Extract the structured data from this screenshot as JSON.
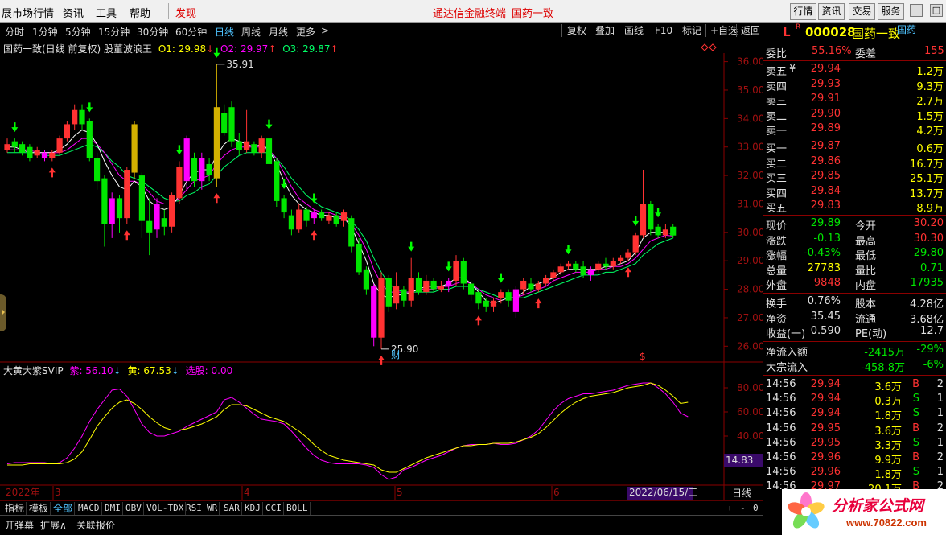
{
  "menubar": {
    "items": [
      "展市场行情",
      "资讯",
      "工具",
      "帮助"
    ],
    "discover": "发现",
    "center_title": "通达信金融终端",
    "center_stock": "国药一致",
    "right_buttons": [
      "行情",
      "资讯",
      "交易",
      "服务"
    ]
  },
  "periods": {
    "items": [
      "分时",
      "1分钟",
      "5分钟",
      "15分钟",
      "30分钟",
      "60分钟",
      "日线",
      "周线",
      "月线",
      "更多"
    ],
    "active": "日线",
    "more_arrow": ">",
    "tools": [
      "复权",
      "叠加",
      "画线",
      "F10",
      "标记",
      "+自选",
      "返回"
    ]
  },
  "main_indicator": {
    "title": "国药一致(日线 前复权) 股董波浪王",
    "o1": "O1: 29.98",
    "o2": "O2: 29.97",
    "o3": "O3: 29.87",
    "high_label": "35.91",
    "low_label": "25.90",
    "fin_marker": "财",
    "s_marker": "$",
    "price_ticks": [
      "36.00",
      "35.00",
      "34.00",
      "33.00",
      "32.00",
      "31.00",
      "30.00",
      "29.00",
      "28.00",
      "27.00",
      "26.00"
    ]
  },
  "sub_indicator": {
    "title": "大黄大紫SVIP",
    "purple": "紫: 56.10",
    "yellow": "黄: 67.53",
    "select": "选股: 0.00",
    "ticks": [
      "80.00",
      "60.00",
      "40.00"
    ],
    "cursor_value": "14.83"
  },
  "date_axis": {
    "year": "2022年",
    "months": [
      "3",
      "4",
      "5",
      "6"
    ],
    "cursor_date": "2022/06/15/三",
    "period_label": "日线",
    "zoom": [
      "+",
      "-",
      "0"
    ]
  },
  "tabs": [
    "指标",
    "模板",
    "全部",
    "MACD",
    "DMI",
    "OBV",
    "VOL-TDX",
    "RSI",
    "WR",
    "SAR",
    "KDJ",
    "CCI",
    "BOLL"
  ],
  "active_tab": "全部",
  "status": [
    "开弹幕",
    "扩展∧",
    "关联报价"
  ],
  "quote": {
    "flag": "L",
    "r_mark": "R",
    "code": "000028",
    "name": "国药一致",
    "tag": "国药",
    "weibi_label": "委比",
    "weibi": "55.16%",
    "weicha_label": "委差",
    "weicha": "155",
    "asks": [
      {
        "label": "卖五",
        "mark": "¥",
        "price": "29.94",
        "vol": "1.2万"
      },
      {
        "label": "卖四",
        "mark": "",
        "price": "29.93",
        "vol": "9.3万"
      },
      {
        "label": "卖三",
        "mark": "",
        "price": "29.91",
        "vol": "2.7万"
      },
      {
        "label": "卖二",
        "mark": "",
        "price": "29.90",
        "vol": "1.5万"
      },
      {
        "label": "卖一",
        "mark": "",
        "price": "29.89",
        "vol": "4.2万"
      }
    ],
    "bids": [
      {
        "label": "买一",
        "price": "29.87",
        "vol": "0.6万"
      },
      {
        "label": "买二",
        "price": "29.86",
        "vol": "16.7万"
      },
      {
        "label": "买三",
        "price": "29.85",
        "vol": "25.1万"
      },
      {
        "label": "买四",
        "price": "29.84",
        "vol": "13.7万"
      },
      {
        "label": "买五",
        "price": "29.83",
        "vol": "8.9万"
      }
    ],
    "stats": [
      {
        "l1": "现价",
        "v1": "29.89",
        "c1": "grn",
        "l2": "今开",
        "v2": "30.20",
        "c2": "red"
      },
      {
        "l1": "涨跌",
        "v1": "-0.13",
        "c1": "grn",
        "l2": "最高",
        "v2": "30.30",
        "c2": "red"
      },
      {
        "l1": "涨幅",
        "v1": "-0.43%",
        "c1": "grn",
        "l2": "最低",
        "v2": "29.80",
        "c2": "grn"
      },
      {
        "l1": "总量",
        "v1": "27783",
        "c1": "yel",
        "l2": "量比",
        "v2": "0.71",
        "c2": "grn"
      },
      {
        "l1": "外盘",
        "v1": "9848",
        "c1": "red",
        "l2": "内盘",
        "v2": "17935",
        "c2": "grn"
      }
    ],
    "fund": [
      {
        "l1": "换手",
        "v1": "0.76%",
        "l2": "股本",
        "v2": "4.28亿"
      },
      {
        "l1": "净资",
        "v1": "35.45",
        "l2": "流通",
        "v2": "3.68亿"
      },
      {
        "l1": "收益(一)",
        "v1": "0.590",
        "l2": "PE(动)",
        "v2": "12.7"
      }
    ],
    "flow": [
      {
        "label": "净流入额",
        "value": "-2415万",
        "pct": "-29%"
      },
      {
        "label": "大宗流入",
        "value": "-458.8万",
        "pct": "-6%"
      }
    ],
    "ticks": [
      {
        "time": "14:56",
        "price": "29.94",
        "vol": "3.6万",
        "bs": "B",
        "n": "2"
      },
      {
        "time": "14:56",
        "price": "29.94",
        "vol": "0.3万",
        "bs": "S",
        "n": "1"
      },
      {
        "time": "14:56",
        "price": "29.94",
        "vol": "1.8万",
        "bs": "S",
        "n": "1"
      },
      {
        "time": "14:56",
        "price": "29.95",
        "vol": "3.6万",
        "bs": "B",
        "n": "2"
      },
      {
        "time": "14:56",
        "price": "29.95",
        "vol": "3.3万",
        "bs": "S",
        "n": "1"
      },
      {
        "time": "14:56",
        "price": "29.96",
        "vol": "9.9万",
        "bs": "B",
        "n": "2"
      },
      {
        "time": "14:56",
        "price": "29.96",
        "vol": "1.8万",
        "bs": "S",
        "n": "1"
      },
      {
        "time": "14:56",
        "price": "29.97",
        "vol": "20.1万",
        "bs": "B",
        "n": "2"
      }
    ]
  },
  "watermark": {
    "text": "分析家公式网",
    "url": "www.70822.com"
  },
  "colors": {
    "up": "#ff3232",
    "down": "#00e600",
    "yellow_candle": "#d4b000",
    "magenta_candle": "#ff00ff",
    "axis": "#8b0000"
  },
  "chart_data": {
    "type": "candlestick",
    "ylim": [
      25.5,
      36.3
    ],
    "candles": [
      [
        32.9,
        33.1,
        32.8,
        33.3
      ],
      [
        33.2,
        33.0,
        32.8,
        33.3
      ],
      [
        33.1,
        32.8,
        32.7,
        33.2
      ],
      [
        33.0,
        32.6,
        32.5,
        33.1
      ],
      [
        32.7,
        32.9,
        32.6,
        33.0
      ],
      [
        32.8,
        32.6,
        32.5,
        32.9
      ],
      [
        32.6,
        32.8,
        32.5,
        32.9
      ],
      [
        32.8,
        33.3,
        32.7,
        33.4
      ],
      [
        33.3,
        33.8,
        33.2,
        33.9
      ],
      [
        33.8,
        34.3,
        33.6,
        34.5
      ],
      [
        34.3,
        33.8,
        33.6,
        34.5
      ],
      [
        33.9,
        32.6,
        32.5,
        34.0
      ],
      [
        32.6,
        31.8,
        31.5,
        32.8
      ],
      [
        31.9,
        30.3,
        29.5,
        32.0
      ],
      [
        30.3,
        31.2,
        29.8,
        31.4
      ],
      [
        31.2,
        30.5,
        30.0,
        31.3
      ],
      [
        30.5,
        32.2,
        30.3,
        32.3
      ],
      [
        32.1,
        33.8,
        31.9,
        33.9
      ],
      [
        32.0,
        30.4,
        29.8,
        32.1
      ],
      [
        30.4,
        30.0,
        29.2,
        31.2
      ],
      [
        30.1,
        31.0,
        29.8,
        31.2
      ],
      [
        30.5,
        30.2,
        29.9,
        30.8
      ],
      [
        30.2,
        31.3,
        30.0,
        31.4
      ],
      [
        31.2,
        32.3,
        31.0,
        32.5
      ],
      [
        31.8,
        33.3,
        31.5,
        33.4
      ],
      [
        32.6,
        31.8,
        31.6,
        32.8
      ],
      [
        31.8,
        32.6,
        31.5,
        32.8
      ],
      [
        32.4,
        32.0,
        31.8,
        32.6
      ],
      [
        31.9,
        34.4,
        31.6,
        35.91
      ],
      [
        34.2,
        33.5,
        33.4,
        34.5
      ],
      [
        34.4,
        33.2,
        33.0,
        34.6
      ],
      [
        33.2,
        32.9,
        32.7,
        33.5
      ],
      [
        32.9,
        33.2,
        32.8,
        34.3
      ],
      [
        33.1,
        32.8,
        32.7,
        33.2
      ],
      [
        32.8,
        33.3,
        32.6,
        33.4
      ],
      [
        33.3,
        32.4,
        32.3,
        33.4
      ],
      [
        32.5,
        31.1,
        30.9,
        32.6
      ],
      [
        31.2,
        30.7,
        30.5,
        31.3
      ],
      [
        30.6,
        30.1,
        29.9,
        30.8
      ],
      [
        30.1,
        30.8,
        30.0,
        31.0
      ],
      [
        30.8,
        30.4,
        30.2,
        30.9
      ],
      [
        30.5,
        30.7,
        30.3,
        30.8
      ],
      [
        30.7,
        30.5,
        30.4,
        30.8
      ],
      [
        30.4,
        30.6,
        30.3,
        30.7
      ],
      [
        30.6,
        30.3,
        30.2,
        30.7
      ],
      [
        30.4,
        30.7,
        30.2,
        30.8
      ],
      [
        30.5,
        29.5,
        29.3,
        30.6
      ],
      [
        29.6,
        28.6,
        28.5,
        29.8
      ],
      [
        28.7,
        28.0,
        27.8,
        28.8
      ],
      [
        28.1,
        26.3,
        26.0,
        28.2
      ],
      [
        26.3,
        28.4,
        25.9,
        28.6
      ],
      [
        28.4,
        27.4,
        27.2,
        28.5
      ],
      [
        27.5,
        28.1,
        27.3,
        28.6
      ],
      [
        28.0,
        27.6,
        27.4,
        28.1
      ],
      [
        27.6,
        28.4,
        27.4,
        29.1
      ],
      [
        28.4,
        27.9,
        27.8,
        28.6
      ],
      [
        27.9,
        28.3,
        27.8,
        28.5
      ],
      [
        28.3,
        28.0,
        27.9,
        28.4
      ],
      [
        28.0,
        28.1,
        27.9,
        28.3
      ],
      [
        28.1,
        28.3,
        27.9,
        28.4
      ],
      [
        28.3,
        29.0,
        28.1,
        29.2
      ],
      [
        29.0,
        28.2,
        28.0,
        29.1
      ],
      [
        28.2,
        27.8,
        27.6,
        28.3
      ],
      [
        27.9,
        27.5,
        27.3,
        28.0
      ],
      [
        27.6,
        27.4,
        27.2,
        27.7
      ],
      [
        27.4,
        27.6,
        27.2,
        27.7
      ],
      [
        27.7,
        27.9,
        27.5,
        28.0
      ],
      [
        27.9,
        27.6,
        27.4,
        28.0
      ],
      [
        27.2,
        28.0,
        27.0,
        28.1
      ],
      [
        28.0,
        28.3,
        27.8,
        28.4
      ],
      [
        28.2,
        28.0,
        27.9,
        28.4
      ],
      [
        28.0,
        28.2,
        27.9,
        28.3
      ],
      [
        28.2,
        28.4,
        28.1,
        28.5
      ],
      [
        28.4,
        28.6,
        28.3,
        28.7
      ],
      [
        28.6,
        28.8,
        28.5,
        28.9
      ],
      [
        28.8,
        28.9,
        28.7,
        29.0
      ],
      [
        28.9,
        28.7,
        28.6,
        29.0
      ],
      [
        28.8,
        28.5,
        28.4,
        29.0
      ],
      [
        28.5,
        28.7,
        28.3,
        28.8
      ],
      [
        28.7,
        28.9,
        28.6,
        29.0
      ],
      [
        28.9,
        28.8,
        28.7,
        29.1
      ],
      [
        28.8,
        29.0,
        28.7,
        29.1
      ],
      [
        29.0,
        29.1,
        28.9,
        29.2
      ],
      [
        29.1,
        29.3,
        29.0,
        29.4
      ],
      [
        29.3,
        29.9,
        29.2,
        30.0
      ],
      [
        29.9,
        31.0,
        29.8,
        32.2
      ],
      [
        31.0,
        30.1,
        29.9,
        31.1
      ],
      [
        30.2,
        29.9,
        29.8,
        30.3
      ],
      [
        29.9,
        30.1,
        29.8,
        30.3
      ],
      [
        30.2,
        29.89,
        29.8,
        30.3
      ]
    ],
    "ma_white": [
      33.0,
      33.0,
      32.9,
      32.8,
      32.8,
      32.8,
      32.8,
      32.9,
      33.1,
      33.4,
      33.6,
      33.5,
      33.1,
      32.5,
      32.0,
      31.6,
      31.5,
      31.8,
      31.6,
      31.1,
      30.9,
      30.8,
      30.9,
      31.3,
      31.8,
      32.1,
      32.2,
      32.2,
      32.7,
      33.1,
      33.3,
      33.2,
      33.1,
      33.0,
      33.1,
      32.9,
      32.4,
      31.8,
      31.3,
      31.0,
      30.8,
      30.7,
      30.6,
      30.6,
      30.5,
      30.5,
      30.2,
      29.6,
      29.0,
      28.2,
      27.8,
      27.7,
      27.8,
      27.8,
      27.9,
      28.0,
      28.1,
      28.1,
      28.1,
      28.2,
      28.4,
      28.4,
      28.2,
      27.9,
      27.6,
      27.5,
      27.6,
      27.7,
      27.7,
      27.9,
      28.1,
      28.2,
      28.3,
      28.4,
      28.6,
      28.7,
      28.7,
      28.7,
      28.7,
      28.7,
      28.8,
      28.8,
      28.9,
      29.0,
      29.3,
      29.8,
      30.0,
      30.0,
      30.0,
      29.95
    ],
    "ma_purple": [
      32.9,
      32.9,
      32.9,
      32.9,
      32.8,
      32.8,
      32.8,
      32.8,
      32.9,
      33.1,
      33.3,
      33.3,
      33.1,
      32.8,
      32.4,
      32.0,
      31.8,
      31.8,
      31.7,
      31.4,
      31.1,
      31.0,
      31.0,
      31.2,
      31.5,
      31.8,
      31.9,
      32.0,
      32.4,
      32.7,
      32.9,
      33.0,
      33.0,
      33.0,
      33.0,
      32.9,
      32.6,
      32.1,
      31.6,
      31.2,
      31.0,
      30.8,
      30.7,
      30.7,
      30.6,
      30.5,
      30.3,
      29.9,
      29.4,
      28.7,
      28.2,
      27.9,
      27.9,
      27.9,
      27.9,
      28.0,
      28.0,
      28.0,
      28.1,
      28.1,
      28.2,
      28.3,
      28.2,
      28.0,
      27.8,
      27.7,
      27.6,
      27.7,
      27.7,
      27.8,
      27.9,
      28.0,
      28.1,
      28.3,
      28.4,
      28.5,
      28.6,
      28.6,
      28.6,
      28.7,
      28.7,
      28.8,
      28.8,
      28.9,
      29.1,
      29.4,
      29.7,
      29.8,
      29.9,
      29.87
    ],
    "ma_green": [
      32.8,
      32.8,
      32.8,
      32.8,
      32.8,
      32.7,
      32.7,
      32.7,
      32.8,
      32.9,
      33.0,
      33.1,
      33.0,
      32.8,
      32.5,
      32.3,
      32.0,
      31.9,
      31.8,
      31.6,
      31.4,
      31.2,
      31.1,
      31.1,
      31.3,
      31.4,
      31.6,
      31.7,
      32.0,
      32.3,
      32.5,
      32.7,
      32.8,
      32.8,
      32.8,
      32.8,
      32.6,
      32.3,
      31.9,
      31.6,
      31.3,
      31.1,
      30.9,
      30.8,
      30.7,
      30.6,
      30.4,
      30.1,
      29.7,
      29.1,
      28.6,
      28.2,
      28.0,
      27.9,
      27.9,
      27.9,
      27.9,
      27.9,
      28.0,
      28.0,
      28.1,
      28.1,
      28.1,
      28.0,
      27.9,
      27.8,
      27.7,
      27.7,
      27.7,
      27.7,
      27.8,
      27.9,
      28.0,
      28.1,
      28.2,
      28.3,
      28.4,
      28.5,
      28.5,
      28.5,
      28.6,
      28.6,
      28.7,
      28.8,
      28.9,
      29.2,
      29.4,
      29.6,
      29.7,
      29.8
    ],
    "down_arrows": [
      1,
      11,
      23,
      28,
      35,
      37,
      41,
      54,
      59,
      66,
      75,
      84,
      87
    ],
    "up_arrows": [
      6,
      16,
      28,
      41,
      50,
      63,
      71,
      83
    ],
    "sub_ylim": [
      0,
      100
    ],
    "sub_purple": [
      17,
      18,
      18,
      18,
      18,
      18,
      17,
      18,
      22,
      30,
      40,
      52,
      62,
      70,
      78,
      79,
      73,
      62,
      50,
      43,
      40,
      40,
      42,
      44,
      48,
      51,
      54,
      57,
      60,
      70,
      72,
      68,
      63,
      58,
      54,
      53,
      52,
      50,
      44,
      37,
      30,
      24,
      20,
      18,
      17,
      17,
      17,
      17,
      16,
      14,
      8,
      4,
      6,
      12,
      14,
      17,
      20,
      22,
      24,
      27,
      30,
      32,
      33,
      33,
      33,
      34,
      33,
      33,
      34,
      37,
      40,
      45,
      53,
      61,
      67,
      71,
      73,
      75,
      75,
      76,
      77,
      78,
      80,
      82,
      83,
      84,
      84,
      80,
      75,
      68,
      59,
      56
    ],
    "sub_yellow": [
      16,
      16,
      16,
      17,
      17,
      17,
      17,
      17,
      18,
      21,
      27,
      37,
      48,
      56,
      63,
      68,
      70,
      67,
      62,
      56,
      51,
      47,
      45,
      45,
      46,
      48,
      50,
      53,
      56,
      62,
      66,
      66,
      65,
      62,
      59,
      56,
      54,
      52,
      48,
      44,
      39,
      33,
      28,
      24,
      22,
      20,
      19,
      18,
      17,
      16,
      12,
      10,
      10,
      13,
      16,
      19,
      22,
      24,
      26,
      28,
      30,
      32,
      32,
      33,
      33,
      34,
      34,
      34,
      35,
      37,
      39,
      42,
      47,
      53,
      59,
      64,
      68,
      71,
      73,
      74,
      75,
      76,
      78,
      80,
      81,
      82,
      84,
      82,
      78,
      73,
      67,
      68
    ]
  }
}
